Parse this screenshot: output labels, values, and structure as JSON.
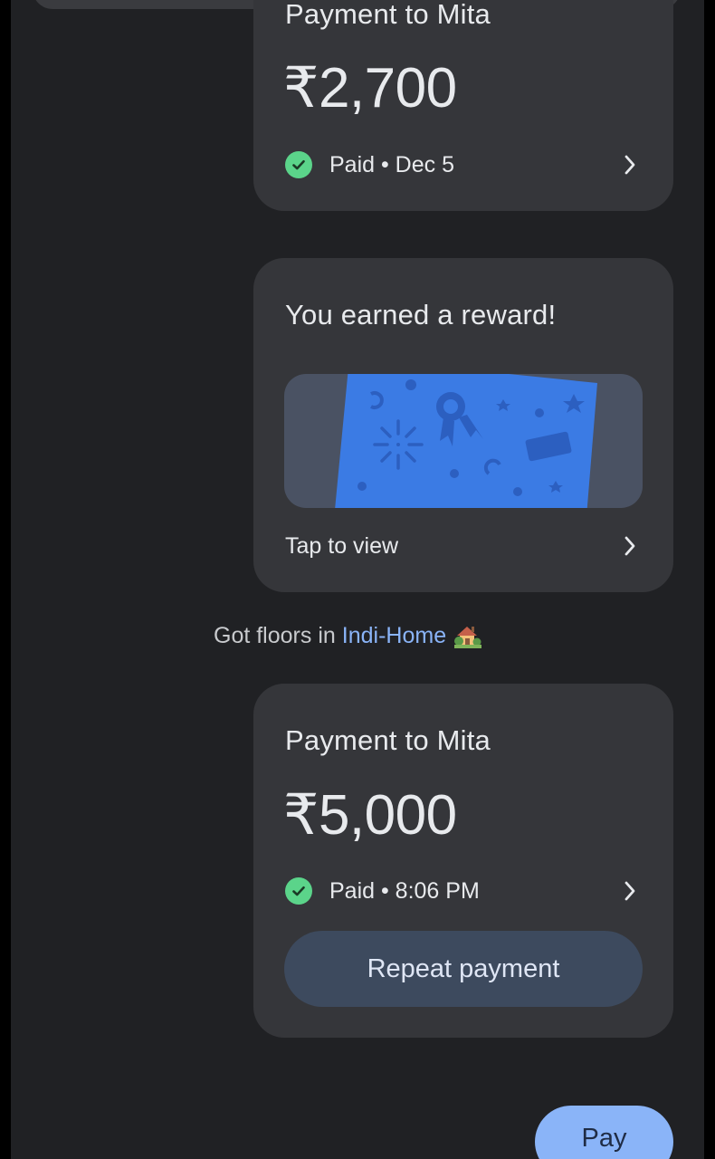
{
  "cards": {
    "first_payment": {
      "title": "Payment to Mita",
      "amount": "₹2,700",
      "status": "Paid • Dec 5"
    },
    "reward": {
      "title": "You earned a reward!",
      "action": "Tap to view"
    },
    "second_payment": {
      "title": "Payment to Mita",
      "amount": "₹5,000",
      "status": "Paid • 8:06 PM",
      "repeat_label": "Repeat payment"
    }
  },
  "note": {
    "prefix": "Got floors in",
    "highlight": "Indi-Home",
    "emoji_icon": "house-with-garden-icon"
  },
  "pay_button": {
    "label": "Pay"
  },
  "colors": {
    "background": "#202124",
    "card": "#35363a",
    "paid_green": "#5bd48a",
    "accent_blue": "#8ab4f8",
    "reward_card_blue": "#3b7be4"
  },
  "icons": [
    "check-icon",
    "chevron-right-icon",
    "reward-scratch-card-icon",
    "house-with-garden-icon"
  ]
}
